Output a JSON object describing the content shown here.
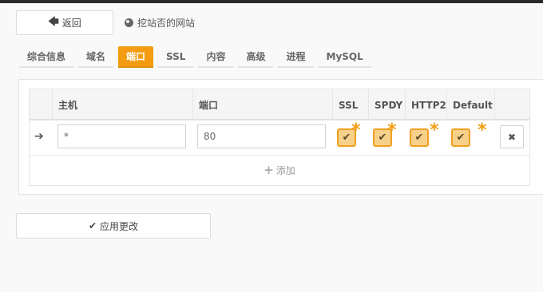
{
  "header": {
    "back_label": "返回",
    "site_title": "挖站否的网站"
  },
  "tabs": [
    {
      "label": "综合信息",
      "active": false
    },
    {
      "label": "域名",
      "active": false
    },
    {
      "label": "端口",
      "active": true
    },
    {
      "label": "SSL",
      "active": false
    },
    {
      "label": "内容",
      "active": false
    },
    {
      "label": "高级",
      "active": false
    },
    {
      "label": "进程",
      "active": false
    },
    {
      "label": "MySQL",
      "active": false
    }
  ],
  "table": {
    "columns": {
      "host": "主机",
      "port": "端口",
      "ssl": "SSL",
      "spdy": "SPDY",
      "http2": "HTTP2",
      "default": "Default"
    },
    "row": {
      "host": "*",
      "port": "80",
      "ssl": true,
      "spdy": true,
      "http2": true,
      "default": true
    },
    "add_label": "添加"
  },
  "footer": {
    "apply_label": "应用更改"
  },
  "colors": {
    "accent": "#f39c12"
  }
}
